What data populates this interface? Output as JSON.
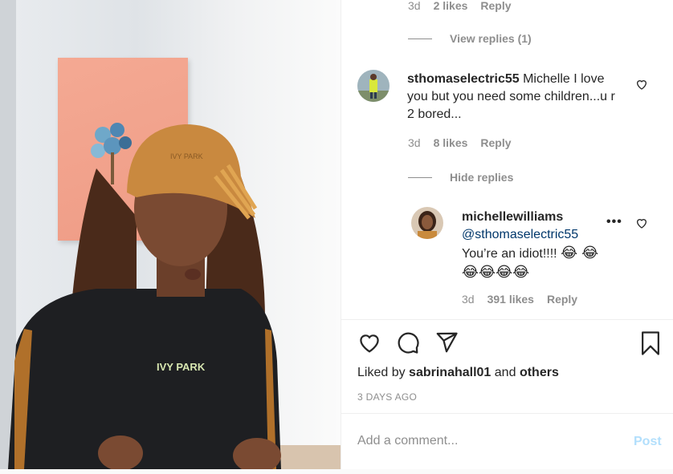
{
  "top_comment_meta": {
    "age": "3d",
    "likes": "2 likes",
    "reply": "Reply"
  },
  "view_replies": "View replies (1)",
  "comment1": {
    "username": "sthomaselectric55",
    "text": "Michelle I love you but you need some children...u r 2 bored...",
    "age": "3d",
    "likes": "8 likes",
    "reply": "Reply"
  },
  "hide_replies": "Hide replies",
  "reply1": {
    "username": "michellewilliams",
    "mention": "@sthomaselectric55",
    "text": "You’re an idiot!!!!",
    "emoji_line1": "😂 😂",
    "emoji_line2": "😂😂😂😂",
    "more": "•••",
    "age": "3d",
    "likes": "391 likes",
    "reply": "Reply"
  },
  "liked_by": {
    "prefix": "Liked by",
    "user": "sabrinahall01",
    "and": "and",
    "others": "others"
  },
  "post_date": "3 DAYS AGO",
  "comment_box": {
    "placeholder": "Add a comment...",
    "post_label": "Post"
  },
  "media": {
    "cap_text": "IVY PARK",
    "hoodie_text": "IVY PARK"
  },
  "icons": [
    "heart-icon",
    "comment-icon",
    "share-icon",
    "bookmark-icon",
    "more-icon"
  ],
  "colors": {
    "link": "#00376b",
    "muted": "#8e8e8e",
    "post_disabled": "#b2dffc",
    "text": "#262626"
  }
}
